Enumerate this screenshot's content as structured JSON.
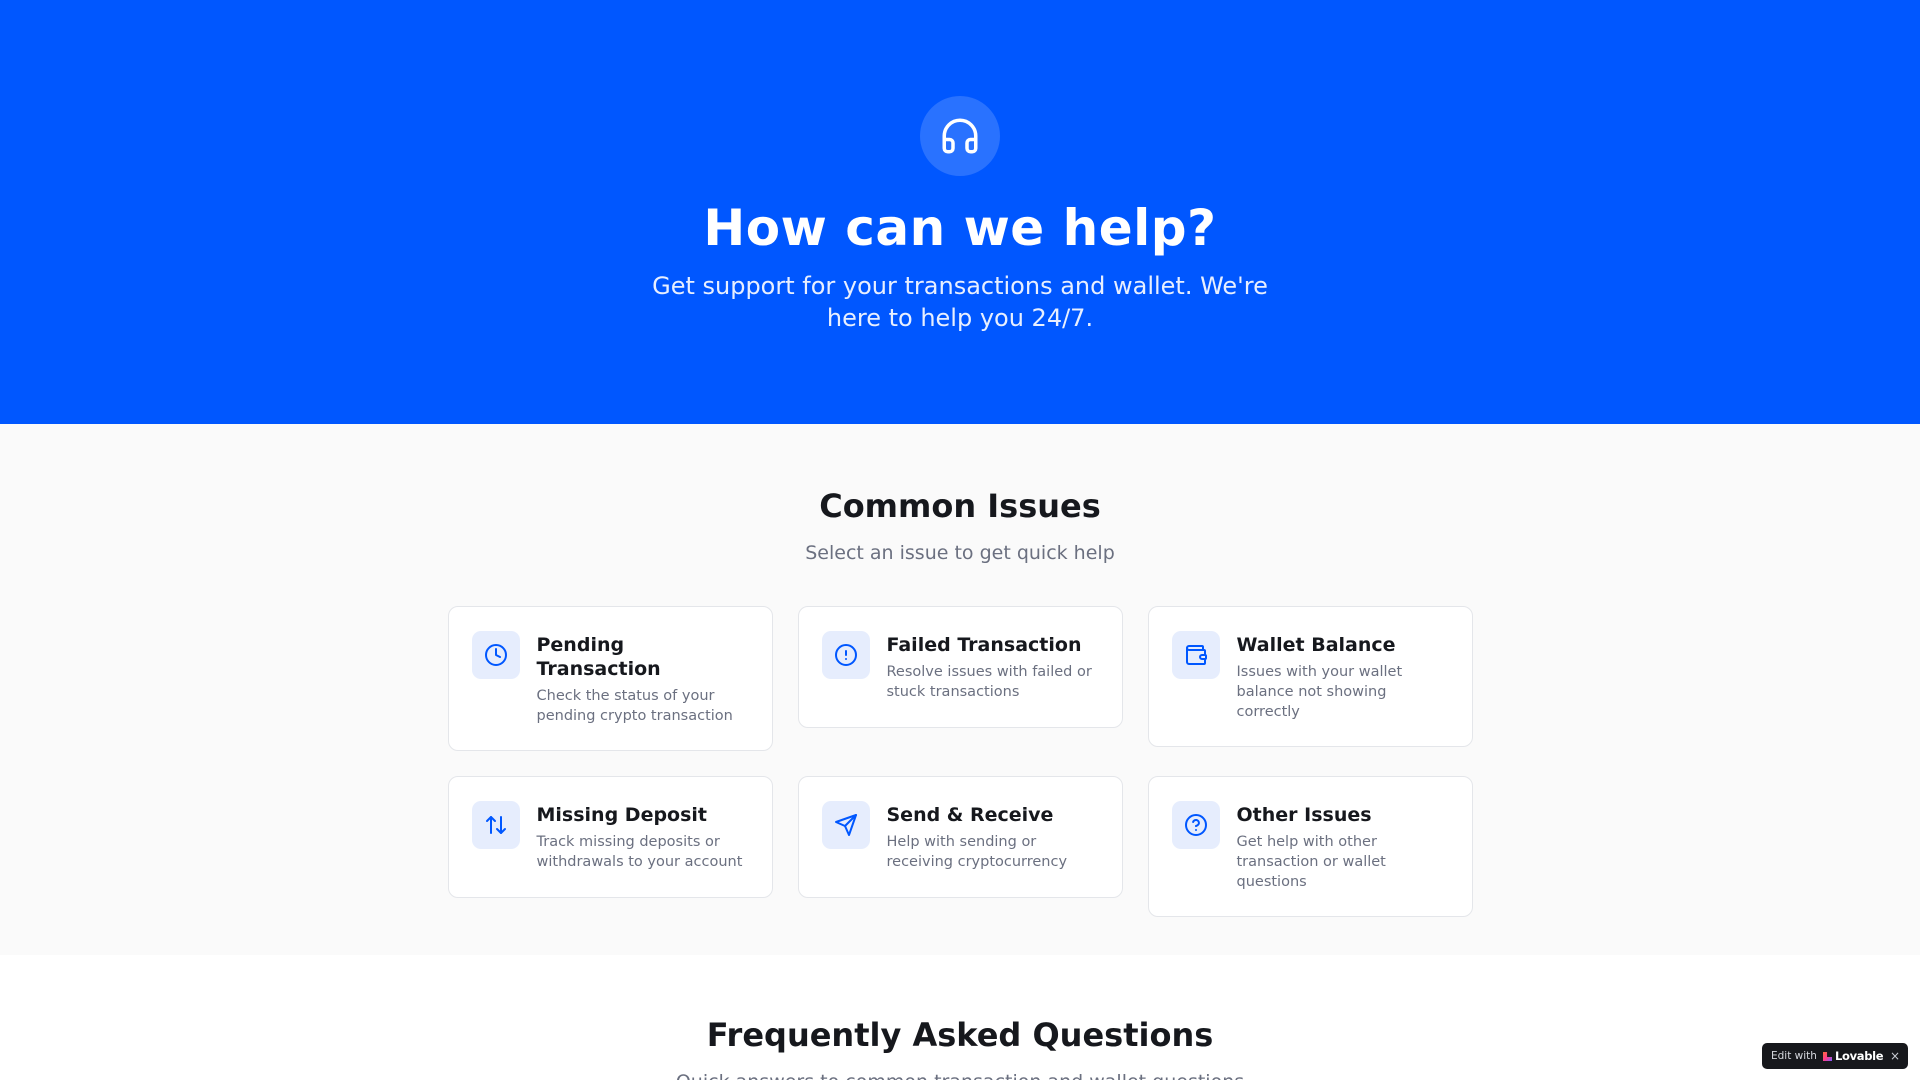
{
  "hero": {
    "icon": "headphones-icon",
    "title": "How can we help?",
    "subtitle": "Get support for your transactions and wallet. We're here to help you 24/7."
  },
  "common_issues": {
    "title": "Common Issues",
    "subtitle": "Select an issue to get quick help",
    "cards": [
      {
        "icon": "clock-icon",
        "title": "Pending Transaction",
        "description": "Check the status of your pending crypto transaction"
      },
      {
        "icon": "alert-circle-icon",
        "title": "Failed Transaction",
        "description": "Resolve issues with failed or stuck transactions"
      },
      {
        "icon": "wallet-icon",
        "title": "Wallet Balance",
        "description": "Issues with your wallet balance not showing correctly"
      },
      {
        "icon": "arrows-up-down-icon",
        "title": "Missing Deposit",
        "description": "Track missing deposits or withdrawals to your account"
      },
      {
        "icon": "send-icon",
        "title": "Send & Receive",
        "description": "Help with sending or receiving cryptocurrency"
      },
      {
        "icon": "help-circle-icon",
        "title": "Other Issues",
        "description": "Get help with other transaction or wallet questions"
      }
    ]
  },
  "faq": {
    "title": "Frequently Asked Questions",
    "subtitle": "Quick answers to common transaction and wallet questions"
  },
  "badge": {
    "prefix": "Edit with",
    "brand": "Lovable",
    "close": "×"
  },
  "colors": {
    "primary": "#0057ff",
    "icon_tile": "#e6edfd",
    "page_bg": "#fafafa",
    "text_dark": "#16181d",
    "text_muted": "#6b7080"
  }
}
